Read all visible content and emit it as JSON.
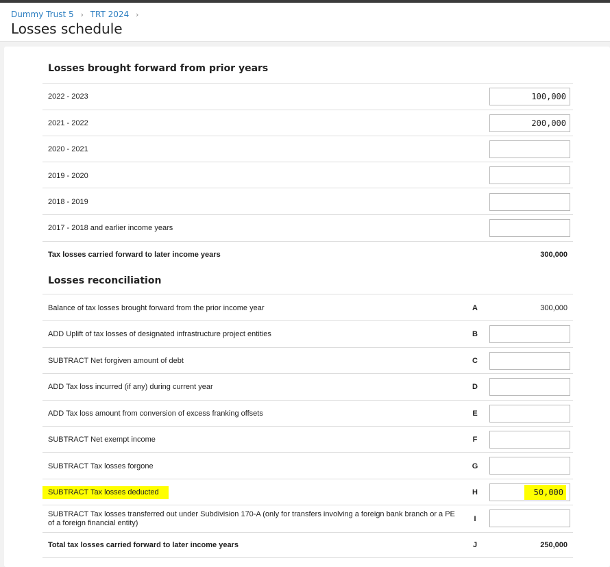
{
  "breadcrumb": {
    "items": [
      "Dummy Trust 5",
      "TRT 2024"
    ]
  },
  "page": {
    "title": "Losses schedule"
  },
  "brought_forward": {
    "heading": "Losses brought forward from prior years",
    "rows": [
      {
        "label": "2022 - 2023",
        "value": "100,000"
      },
      {
        "label": "2021 - 2022",
        "value": "200,000"
      },
      {
        "label": "2020 - 2021",
        "value": ""
      },
      {
        "label": "2019 - 2020",
        "value": ""
      },
      {
        "label": "2018 - 2019",
        "value": ""
      },
      {
        "label": "2017 - 2018 and earlier income years",
        "value": ""
      }
    ],
    "total_label": "Tax losses carried forward to later income years",
    "total_value": "300,000"
  },
  "reconciliation": {
    "heading": "Losses reconciliation",
    "rows": [
      {
        "label": "Balance of tax losses brought forward from the prior income year",
        "code": "A",
        "value": "300,000"
      },
      {
        "label": "ADD Uplift of tax losses of designated infrastructure project entities",
        "code": "B",
        "value": ""
      },
      {
        "label": "SUBTRACT Net forgiven amount of debt",
        "code": "C",
        "value": ""
      },
      {
        "label": "ADD Tax loss incurred (if any) during current year",
        "code": "D",
        "value": ""
      },
      {
        "label": "ADD Tax loss amount from conversion of excess franking offsets",
        "code": "E",
        "value": ""
      },
      {
        "label": "SUBTRACT Net exempt income",
        "code": "F",
        "value": ""
      },
      {
        "label": "SUBTRACT Tax losses forgone",
        "code": "G",
        "value": ""
      },
      {
        "label": "SUBTRACT Tax losses deducted",
        "code": "H",
        "value": "50,000"
      },
      {
        "label": "SUBTRACT Tax losses transferred out under Subdivision 170-A (only for transfers involving a foreign bank branch or a PE of a foreign financial entity)",
        "code": "I",
        "value": ""
      }
    ],
    "total_label": "Total tax losses carried forward to later income years",
    "total_code": "J",
    "total_value": "250,000"
  },
  "colors": {
    "link": "#2a7dc0",
    "highlight": "#ffff00",
    "topbar": "#3b3b3b"
  },
  "icons": {
    "breadcrumb_separator": "chevron-right-icon"
  }
}
